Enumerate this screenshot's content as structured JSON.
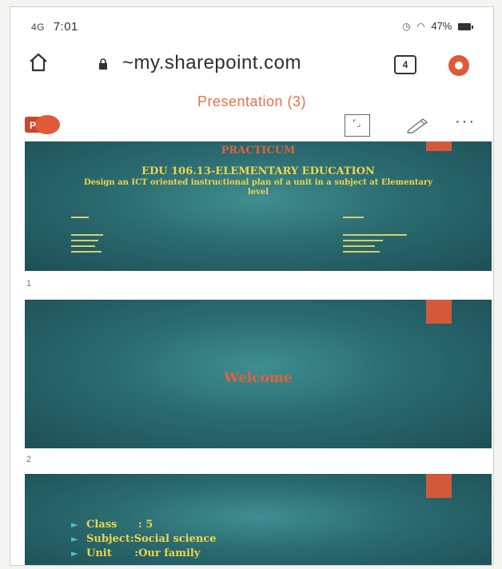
{
  "status_bar": {
    "signal": "4G",
    "time": "7:01",
    "extra": "",
    "battery": "47%"
  },
  "browser": {
    "url": "~my.sharepoint.com",
    "tab_count": "4"
  },
  "header": {
    "title": "Presentation (3)"
  },
  "slides": [
    {
      "number": "1",
      "heading": "PRACTICUM",
      "title": "EDU 106.13-ELEMENTARY EDUCATION",
      "subtitle": "Design an ICT oriented instructional plan of a unit in a subject at Elementary level"
    },
    {
      "number": "2",
      "text": "Welcome"
    },
    {
      "bullets": [
        {
          "label": "Class",
          "value": ": 5"
        },
        {
          "label": "Subject",
          "value": ":Social science"
        },
        {
          "label": "Unit",
          "value": ":Our family"
        }
      ]
    }
  ],
  "colors": {
    "accent": "#e8704a",
    "slide_bg": "#2a6b70",
    "slide_tab": "#d4593a",
    "slide_text_yellow": "#f0d54a",
    "slide_text_orange": "#e0633c"
  }
}
